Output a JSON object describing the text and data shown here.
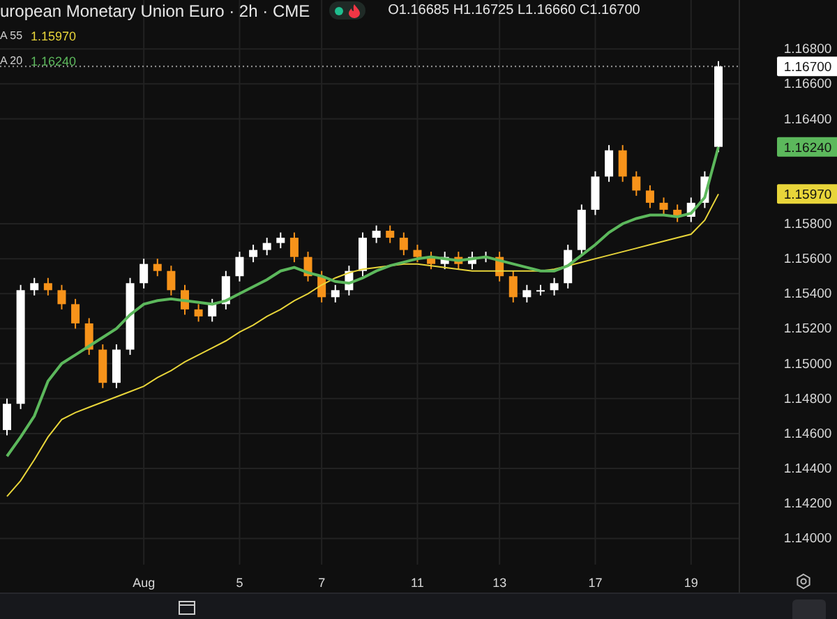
{
  "legend": {
    "title": "uropean Monetary Union Euro · 2h · CME",
    "live": true,
    "ohlc": "O1.16685 H1.16725 L1.16660 C1.16700",
    "indicators": [
      {
        "value": "1.15970"
      },
      {
        "value": "1.16240"
      }
    ]
  },
  "chart_data": {
    "type": "candlestick",
    "ylim": [
      1.1385,
      1.1708
    ],
    "yticks": [
      {
        "value": 1.168,
        "label": "1.16800"
      },
      {
        "value": 1.166,
        "label": "1.16600"
      },
      {
        "value": 1.164,
        "label": "1.16400"
      },
      {
        "value": 1.158,
        "label": "1.15800"
      },
      {
        "value": 1.156,
        "label": "1.15600"
      },
      {
        "value": 1.154,
        "label": "1.15400"
      },
      {
        "value": 1.152,
        "label": "1.15200"
      },
      {
        "value": 1.15,
        "label": "1.15000"
      },
      {
        "value": 1.148,
        "label": "1.14800"
      },
      {
        "value": 1.146,
        "label": "1.14600"
      },
      {
        "value": 1.144,
        "label": "1.14400"
      },
      {
        "value": 1.142,
        "label": "1.14200"
      },
      {
        "value": 1.14,
        "label": "1.14000"
      }
    ],
    "categories": [
      null,
      null,
      null,
      null,
      null,
      null,
      null,
      null,
      null,
      null,
      "Aug",
      null,
      null,
      null,
      null,
      null,
      null,
      "5",
      null,
      null,
      null,
      null,
      null,
      "7",
      null,
      null,
      null,
      null,
      null,
      null,
      "11",
      null,
      null,
      null,
      null,
      null,
      "13",
      null,
      null,
      null,
      null,
      null,
      null,
      "17",
      null,
      null,
      null,
      null,
      null,
      null,
      "19",
      null,
      null
    ],
    "ohlc": [
      [
        1.1462,
        1.148,
        1.1459,
        1.1477
      ],
      [
        1.1477,
        1.1545,
        1.1474,
        1.1542
      ],
      [
        1.1542,
        1.1549,
        1.1539,
        1.1546
      ],
      [
        1.1546,
        1.1549,
        1.1539,
        1.1542
      ],
      [
        1.1542,
        1.1545,
        1.1531,
        1.1534
      ],
      [
        1.1534,
        1.1537,
        1.152,
        1.1523
      ],
      [
        1.1523,
        1.1526,
        1.1505,
        1.1508
      ],
      [
        1.1508,
        1.1511,
        1.1486,
        1.1489
      ],
      [
        1.1489,
        1.1511,
        1.1486,
        1.1508
      ],
      [
        1.1508,
        1.1549,
        1.1505,
        1.1546
      ],
      [
        1.1546,
        1.156,
        1.1543,
        1.1557
      ],
      [
        1.1557,
        1.156,
        1.155,
        1.1553
      ],
      [
        1.1553,
        1.1556,
        1.1539,
        1.1542
      ],
      [
        1.1542,
        1.1545,
        1.1528,
        1.1531
      ],
      [
        1.1531,
        1.1534,
        1.1524,
        1.1527
      ],
      [
        1.1527,
        1.1537,
        1.1524,
        1.1534
      ],
      [
        1.1534,
        1.1553,
        1.1531,
        1.155
      ],
      [
        1.155,
        1.1564,
        1.1547,
        1.1561
      ],
      [
        1.1561,
        1.1568,
        1.1558,
        1.1565
      ],
      [
        1.1565,
        1.1572,
        1.1562,
        1.1569
      ],
      [
        1.1569,
        1.1575,
        1.1566,
        1.1572
      ],
      [
        1.1572,
        1.1575,
        1.1558,
        1.1561
      ],
      [
        1.1561,
        1.1564,
        1.1547,
        1.155
      ],
      [
        1.155,
        1.1553,
        1.1535,
        1.1538
      ],
      [
        1.1538,
        1.1545,
        1.1535,
        1.1542
      ],
      [
        1.1542,
        1.1556,
        1.1539,
        1.1553
      ],
      [
        1.1553,
        1.1575,
        1.155,
        1.1572
      ],
      [
        1.1572,
        1.1579,
        1.1569,
        1.1576
      ],
      [
        1.1576,
        1.1579,
        1.1569,
        1.1572
      ],
      [
        1.1572,
        1.1575,
        1.1562,
        1.1565
      ],
      [
        1.1565,
        1.1568,
        1.1558,
        1.1561
      ],
      [
        1.1561,
        1.1564,
        1.1554,
        1.1557
      ],
      [
        1.1557,
        1.1564,
        1.1554,
        1.1561
      ],
      [
        1.1561,
        1.1564,
        1.1554,
        1.1557
      ],
      [
        1.1557,
        1.1564,
        1.1554,
        1.1561
      ],
      [
        1.1561,
        1.1564,
        1.1558,
        1.1561
      ],
      [
        1.1561,
        1.1564,
        1.1547,
        1.155
      ],
      [
        1.155,
        1.1553,
        1.1535,
        1.1538
      ],
      [
        1.1538,
        1.1545,
        1.1535,
        1.1542
      ],
      [
        1.1542,
        1.1545,
        1.1539,
        1.1542
      ],
      [
        1.1542,
        1.1549,
        1.1539,
        1.1546
      ],
      [
        1.1546,
        1.1568,
        1.1543,
        1.1565
      ],
      [
        1.1565,
        1.1591,
        1.1562,
        1.1588
      ],
      [
        1.1588,
        1.161,
        1.1585,
        1.1607
      ],
      [
        1.1607,
        1.1625,
        1.1604,
        1.1622
      ],
      [
        1.1622,
        1.1625,
        1.1604,
        1.1607
      ],
      [
        1.1607,
        1.161,
        1.1596,
        1.1599
      ],
      [
        1.1599,
        1.1602,
        1.1589,
        1.1592
      ],
      [
        1.1592,
        1.1595,
        1.1585,
        1.1588
      ],
      [
        1.1588,
        1.1591,
        1.1581,
        1.1584
      ],
      [
        1.1584,
        1.1595,
        1.1581,
        1.1592
      ],
      [
        1.1592,
        1.161,
        1.1589,
        1.1607
      ],
      [
        1.1624,
        1.1673,
        1.1621,
        1.167
      ]
    ],
    "series": [
      {
        "name": "A 55",
        "type": "line",
        "color": "#e8d53a",
        "values": [
          1.1424,
          1.1433,
          1.1445,
          1.1458,
          1.1468,
          1.1472,
          1.1475,
          1.1478,
          1.1481,
          1.1484,
          1.1487,
          1.1492,
          1.1496,
          1.1501,
          1.1505,
          1.1509,
          1.1513,
          1.1518,
          1.1522,
          1.1527,
          1.1531,
          1.1536,
          1.154,
          1.1545,
          1.1549,
          1.1552,
          1.1554,
          1.1555,
          1.1556,
          1.1557,
          1.1557,
          1.1556,
          1.1555,
          1.1554,
          1.1553,
          1.1553,
          1.1553,
          1.1553,
          1.1553,
          1.1553,
          1.1554,
          1.1556,
          1.1558,
          1.156,
          1.1562,
          1.1564,
          1.1566,
          1.1568,
          1.157,
          1.1572,
          1.1574,
          1.1582,
          1.1597
        ]
      },
      {
        "name": "A 20",
        "type": "line",
        "color": "#5cb85c",
        "values": [
          1.1447,
          1.1458,
          1.147,
          1.149,
          1.15,
          1.1505,
          1.151,
          1.1515,
          1.152,
          1.1528,
          1.1534,
          1.1536,
          1.1537,
          1.1536,
          1.1535,
          1.1534,
          1.1536,
          1.154,
          1.1544,
          1.1548,
          1.1553,
          1.1555,
          1.1552,
          1.155,
          1.1547,
          1.1546,
          1.1549,
          1.1553,
          1.1556,
          1.1558,
          1.156,
          1.1561,
          1.156,
          1.1559,
          1.156,
          1.1561,
          1.1559,
          1.1557,
          1.1555,
          1.1553,
          1.1553,
          1.1556,
          1.1562,
          1.1568,
          1.1575,
          1.158,
          1.1583,
          1.1585,
          1.1585,
          1.1584,
          1.1586,
          1.1595,
          1.1624
        ]
      }
    ],
    "grid": true,
    "ref_lines": [
      {
        "axis": "y",
        "value": 1.167,
        "color": "#9a9a9a"
      }
    ]
  },
  "price_axis_badges": [
    {
      "text": "1.16700",
      "color": "#ffffff"
    },
    {
      "text": "1.16240",
      "color": "#5cb85c"
    },
    {
      "text": "1.15970",
      "color": "#e8d53a"
    }
  ]
}
